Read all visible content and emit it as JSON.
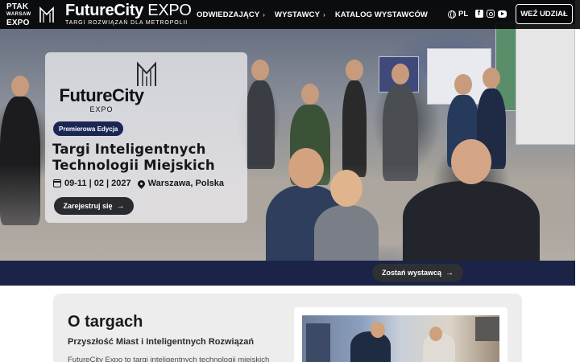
{
  "header": {
    "ptak_logo": {
      "line1": "PTAK",
      "line2": "WARSAW",
      "line3": "EXPO"
    },
    "brand_name_bold": "FutureCity",
    "brand_name_light": "EXPO",
    "brand_tagline": "TARGI ROZWIĄZAŃ DLA METROPOLII",
    "nav": [
      {
        "label": "ODWIEDZAJĄCY",
        "chevron": "›"
      },
      {
        "label": "WYSTAWCY",
        "chevron": "›"
      },
      {
        "label": "KATALOG WYSTAWCÓW"
      }
    ],
    "language": "PL",
    "social_icons": [
      "facebook-icon",
      "instagram-icon",
      "youtube-icon"
    ],
    "cta_label": "WEŹ UDZIAŁ"
  },
  "hero": {
    "logo_name": "FutureCity",
    "logo_expo": "EXPO",
    "badge": "Premierowa Edycja",
    "title": "Targi Inteligentnych Technologii Miejskich",
    "date": "09-11 | 02 | 2027",
    "location": "Warszawa, Polska",
    "register_label": "Zarejestruj się",
    "arrow": "→"
  },
  "strip": {
    "exhibitor_label": "Zostań wystawcą",
    "arrow": "→"
  },
  "about": {
    "title": "O targach",
    "subtitle": "Przyszłość Miast i Inteligentnych Rozwiązań",
    "text": "FutureCity Expo to targi inteligentnych technologii miejskich"
  },
  "colors": {
    "navy": "#1b2346",
    "badge_navy": "#1b2653",
    "dark_button": "#2a2b2e"
  }
}
